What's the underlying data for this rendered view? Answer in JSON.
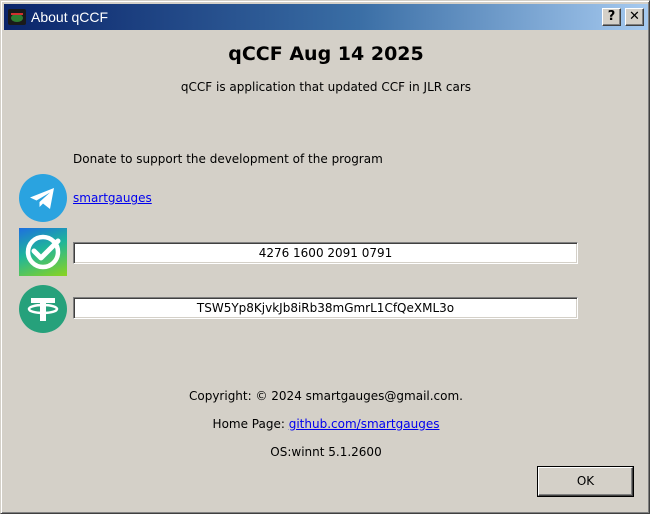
{
  "window": {
    "title": "About qCCF",
    "help_label": "?",
    "close_label": "✕"
  },
  "header": {
    "title": "qCCF Aug 14 2025",
    "subtitle": "qCCF is application that updated CCF in JLR cars"
  },
  "donate": {
    "label": "Donate to support the development of the program",
    "telegram": {
      "icon": "telegram-icon",
      "link": "smartgauges"
    },
    "card": {
      "icon": "sber-icon",
      "number": "4276 1600 2091 0791"
    },
    "usdt": {
      "icon": "tether-icon",
      "address": "TSW5Yp8KjvkJb8iRb38mGmrL1CfQeXML3o"
    }
  },
  "footer": {
    "copyright": "Copyright: © 2024 smartgauges@gmail.com.",
    "homepage_label": "Home Page: ",
    "homepage_link": "github.com/smartgauges",
    "os": "OS:winnt 5.1.2600"
  },
  "buttons": {
    "ok": "OK"
  },
  "colors": {
    "telegram": "#2aa3e0",
    "tether": "#26a17b",
    "titlebar_start": "#0a246a",
    "titlebar_end": "#a6caf0"
  }
}
